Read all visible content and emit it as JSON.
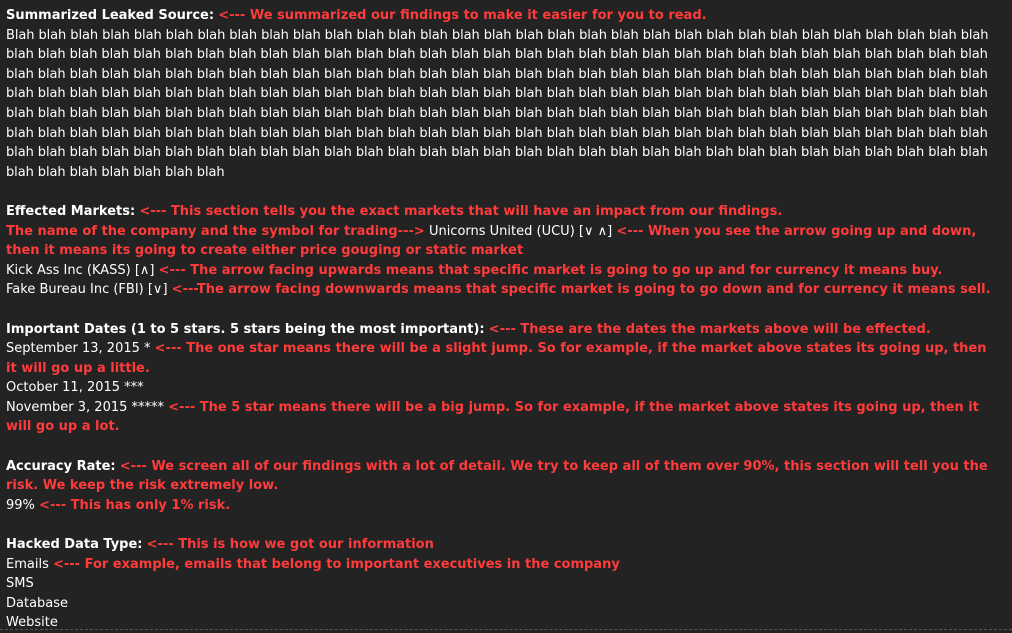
{
  "summary": {
    "heading": "Summarized Leaked Source:",
    "note": "<--- We summarized our findings to make it easier for you to read.",
    "body": "Blah blah blah blah blah blah blah blah blah blah blah blah blah blah blah blah blah blah blah blah blah blah blah blah blah blah blah blah blah blah blah blah blah blah blah blah blah blah blah blah blah blah blah blah blah blah blah blah blah blah blah blah blah blah blah blah blah blah blah blah blah blah blah blah blah blah blah blah blah blah blah blah blah blah blah blah blah blah blah blah blah blah blah blah blah blah blah blah blah blah blah blah blah blah blah blah blah blah blah blah blah blah blah blah blah blah blah blah blah blah blah blah blah blah blah blah blah blah blah blah blah blah blah blah blah blah blah blah blah blah blah blah blah blah blah blah blah blah blah blah blah blah blah blah blah blah blah blah blah blah blah blah blah blah blah blah blah blah blah blah blah blah blah blah blah blah blah blah blah blah blah blah blah blah blah blah blah blah blah blah blah blah blah blah blah blah blah blah blah blah blah blah blah blah blah blah blah blah blah blah blah blah blah blah blah blah blah blah blah blah blah blah blah blah blah blah blah blah blah blah blah blah blah blah"
  },
  "markets": {
    "heading": "Effected Markets:",
    "note": "<--- This section tells you the exact markets that will have an impact from our findings.",
    "intro": "The name of the company and the symbol for trading--->",
    "item1": "Unicorns United (UCU) [∨ ∧]",
    "item1_note": "<--- When you see the arrow going up and down, then it means its going to create either price gouging or static market",
    "item2": "Kick Ass Inc (KASS) [∧]",
    "item2_note": "<--- The arrow facing upwards means that specific market is going to go up and for currency it means buy.",
    "item3": "Fake Bureau Inc (FBI) [∨]",
    "item3_note": "<---The arrow facing downwards means that specific market is going to go down and for currency it means sell."
  },
  "dates": {
    "heading": "Important Dates (1 to 5 stars. 5 stars being the most important):",
    "note": "<--- These are the dates the markets above will be effected.",
    "date1": "September 13, 2015 *",
    "date1_note": "<--- The one star means there will be a slight jump. So for example, if the market above states its going up, then it will go up a little.",
    "date2": "October 11, 2015 ***",
    "date3": "November 3, 2015 *****",
    "date3_note": "<--- The 5 star means there will be a big jump. So for example, if the market above states its going up, then it will go up a lot."
  },
  "accuracy": {
    "heading": "Accuracy Rate:",
    "note": "<--- We screen all of our findings with a lot of detail. We try to keep all of them over 90%, this section will tell you the risk. We keep the risk extremely low.",
    "value": "99%",
    "value_note": "<--- This has only 1% risk."
  },
  "hacked": {
    "heading": "Hacked Data Type:",
    "note": "<--- This is how we got our information",
    "type1": "Emails",
    "type1_note": "<--- For example, emails that belong to important executives in the company",
    "type2": "SMS",
    "type3": "Database",
    "type4": "Website"
  }
}
